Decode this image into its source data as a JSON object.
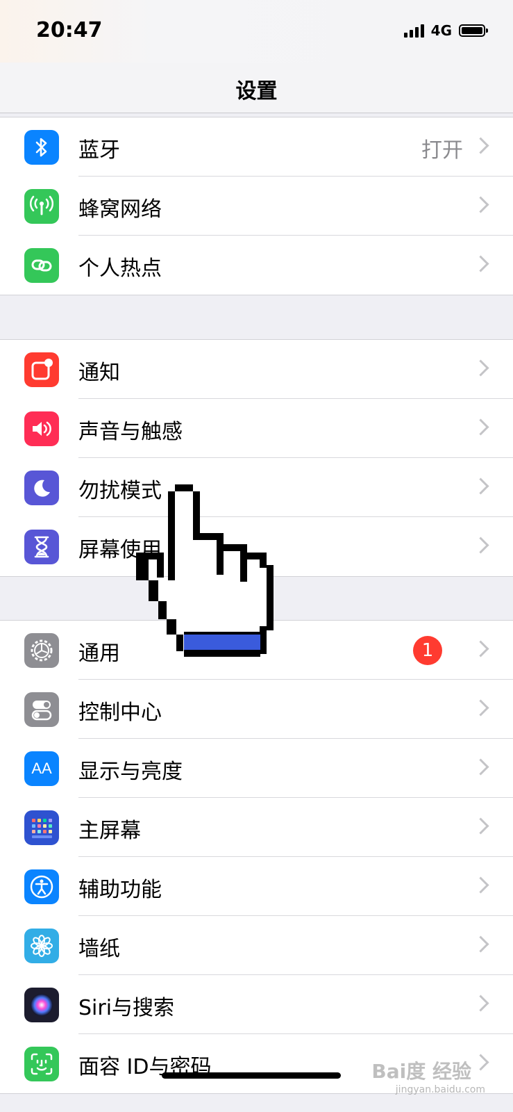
{
  "status_bar": {
    "time": "20:47",
    "network": "4G"
  },
  "nav": {
    "title": "设置"
  },
  "groups": [
    {
      "rows": [
        {
          "label": "蓝牙",
          "detail": "打开",
          "icon": "bluetooth-icon",
          "color": "#0a84ff"
        },
        {
          "label": "蜂窝网络",
          "icon": "antenna-icon",
          "color": "#34c759"
        },
        {
          "label": "个人热点",
          "icon": "link-chain-icon",
          "color": "#34c759"
        }
      ]
    },
    {
      "rows": [
        {
          "label": "通知",
          "icon": "notification-icon",
          "color": "#ff3b30"
        },
        {
          "label": "声音与触感",
          "icon": "speaker-icon",
          "color": "#ff2d55"
        },
        {
          "label": "勿扰模式",
          "icon": "moon-icon",
          "color": "#5856d6"
        },
        {
          "label": "屏幕使用",
          "icon": "hourglass-icon",
          "color": "#5856d6"
        }
      ]
    },
    {
      "rows": [
        {
          "label": "通用",
          "badge": "1",
          "icon": "gear-icon",
          "color": "#8e8e93"
        },
        {
          "label": "控制中心",
          "icon": "toggles-icon",
          "color": "#8e8e93"
        },
        {
          "label": "显示与亮度",
          "icon_text": "AA",
          "icon": "text-size-icon",
          "color": "#0a84ff"
        },
        {
          "label": "主屏幕",
          "icon": "home-grid-icon",
          "color": "#2e52d0"
        },
        {
          "label": "辅助功能",
          "icon": "accessibility-icon",
          "color": "#0a84ff"
        },
        {
          "label": "墙纸",
          "icon": "flower-icon",
          "color": "#32ade6"
        },
        {
          "label": "Siri与搜索",
          "icon": "siri-icon",
          "color": "#1c1c2e"
        },
        {
          "label": "面容 ID与密码",
          "icon": "face-id-icon",
          "color": "#34c759"
        }
      ]
    }
  ],
  "watermark": {
    "text": "Bai度 经验",
    "url": "jingyan.baidu.com"
  }
}
